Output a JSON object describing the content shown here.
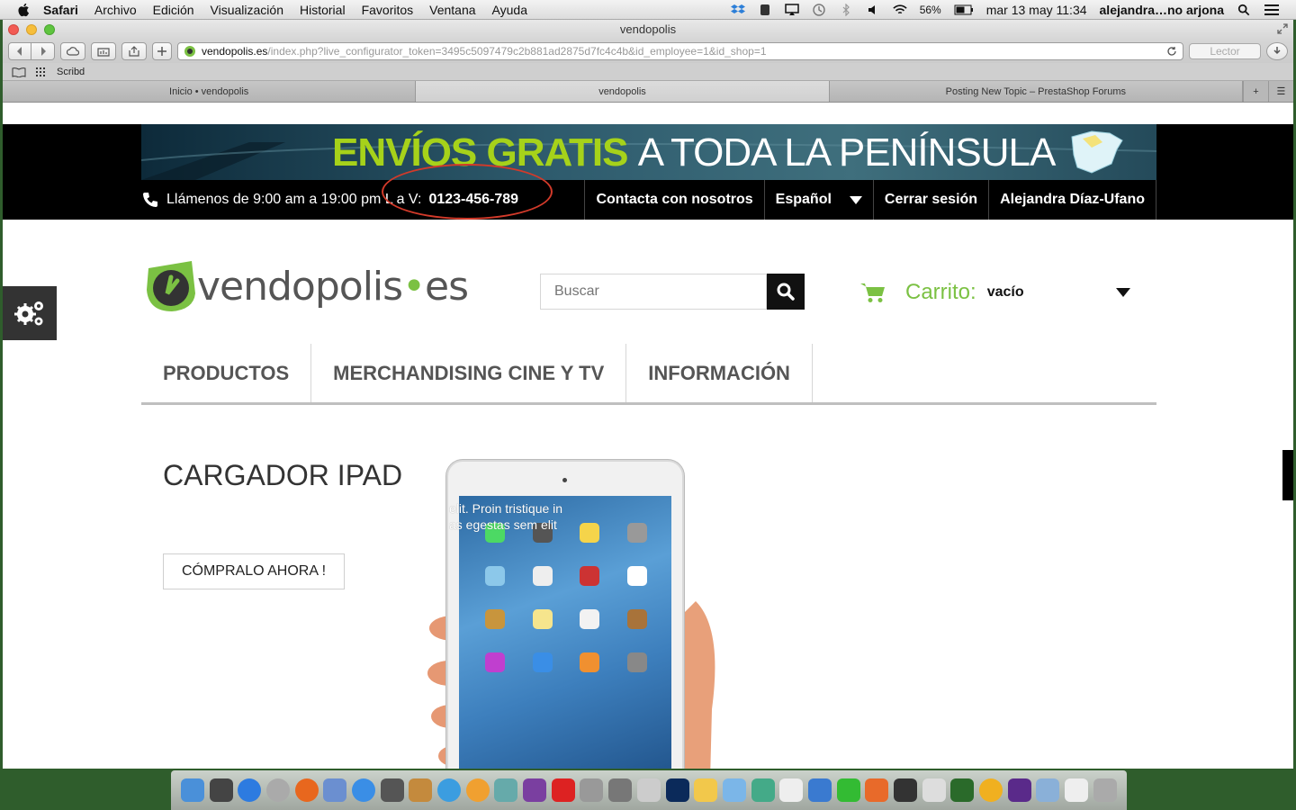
{
  "menubar": {
    "app": "Safari",
    "items": [
      "Archivo",
      "Edición",
      "Visualización",
      "Historial",
      "Favoritos",
      "Ventana",
      "Ayuda"
    ],
    "battery": "56%",
    "datetime": "mar 13 may  11:34",
    "user": "alejandra…no arjona"
  },
  "window": {
    "title": "vendopolis",
    "url_domain": "vendopolis.es",
    "url_path": "/index.php?live_configurator_token=3495c5097479c2b881ad2875d7fc4c4b&id_employee=1&id_shop=1",
    "reader_label": "Lector",
    "bookmark": "Scribd",
    "tabs": [
      {
        "label": "Inicio • vendopolis"
      },
      {
        "label": "vendopolis"
      },
      {
        "label": "Posting New Topic – PrestaShop Forums"
      }
    ]
  },
  "site": {
    "banner": {
      "green": "ENVÍOS GRATIS",
      "white": "A TODA LA PENÍNSULA"
    },
    "phone_prefix": "Llámenos de 9:00 am a 19:00 pm L a V:",
    "phone_number": "0123-456-789",
    "nav_links": {
      "contact": "Contacta con nosotros",
      "language": "Español",
      "logout": "Cerrar sesión",
      "user": "Alejandra Díaz-Ufano"
    },
    "logo": {
      "word": "vendopolis",
      "tld": "es"
    },
    "search_placeholder": "Buscar",
    "cart": {
      "label": "Carrito:",
      "value": "vacío"
    },
    "main_nav": [
      "PRODUCTOS",
      "MERCHANDISING CINE Y TV",
      "INFORMACIÓN"
    ],
    "hero": {
      "title": "CARGADOR IPAD",
      "button": "CÓMPRALO AHORA !",
      "overlay_line1": "elit. Proin tristique in",
      "overlay_line2": "as egestas sem elit"
    }
  },
  "colors": {
    "brand_green": "#7bc143",
    "banner_green": "#a6d21a",
    "annotation_red": "#d23a2a"
  },
  "icons": [
    "apple-icon",
    "phone-icon",
    "gear-icon",
    "search-icon",
    "cart-icon",
    "caret-down-icon"
  ]
}
